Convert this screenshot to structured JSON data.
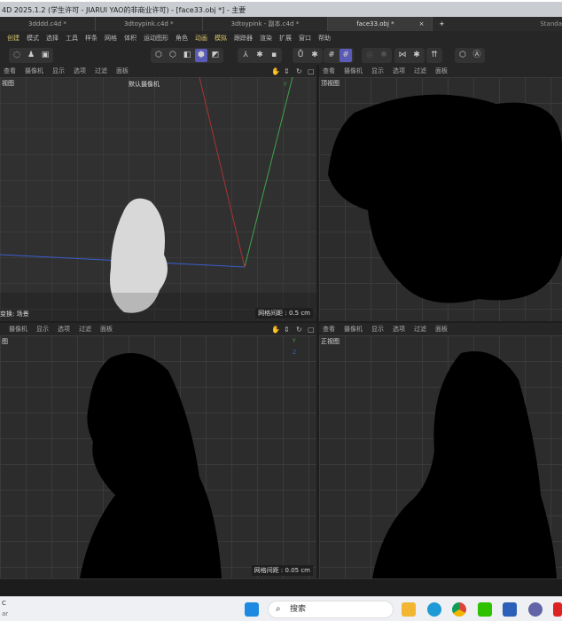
{
  "window": {
    "title": "4D 2025.1.2  (学生许可 - JIARUI YAO的非商业许可)  - [face33.obj *] - 主要"
  },
  "tabs": [
    {
      "label": "3dddd.c4d *"
    },
    {
      "label": "3dtoypink.c4d *"
    },
    {
      "label": "3dtoypink - 副本.c4d *"
    },
    {
      "label": "face33.obj *",
      "active": true
    }
  ],
  "tab_close": "×",
  "tab_add": "+",
  "layout_label": "Standa",
  "menu": [
    "创建",
    "模式",
    "选择",
    "工具",
    "样条",
    "网格",
    "体积",
    "运动图形",
    "角色",
    "动画",
    "模拟",
    "跟踪器",
    "渲染",
    "扩展",
    "窗口",
    "帮助"
  ],
  "menu_highlight_color": "#d7c36a",
  "viewport_menu": [
    "查看",
    "摄像机",
    "显示",
    "选项",
    "过滤",
    "面板"
  ],
  "viewport_menu_bl": [
    "摄像机",
    "显示",
    "选项",
    "过滤",
    "面板"
  ],
  "viewports": {
    "perspective": {
      "label": "视图",
      "camera": "默认摄像机",
      "bottom_left": "变换: 场景",
      "grid": "网格间距 : 0.5 cm"
    },
    "top": {
      "label": "顶视图"
    },
    "right": {
      "label": "图",
      "grid": "网格间距 : 0.05 cm"
    },
    "front": {
      "label": "正视图"
    }
  },
  "axis": {
    "y": "Y",
    "z": "Z",
    "x": "X"
  },
  "taskbar": {
    "search_placeholder": "搜索",
    "left_text1": "C",
    "left_text2": "ar"
  },
  "accent": "#5a5ab8"
}
